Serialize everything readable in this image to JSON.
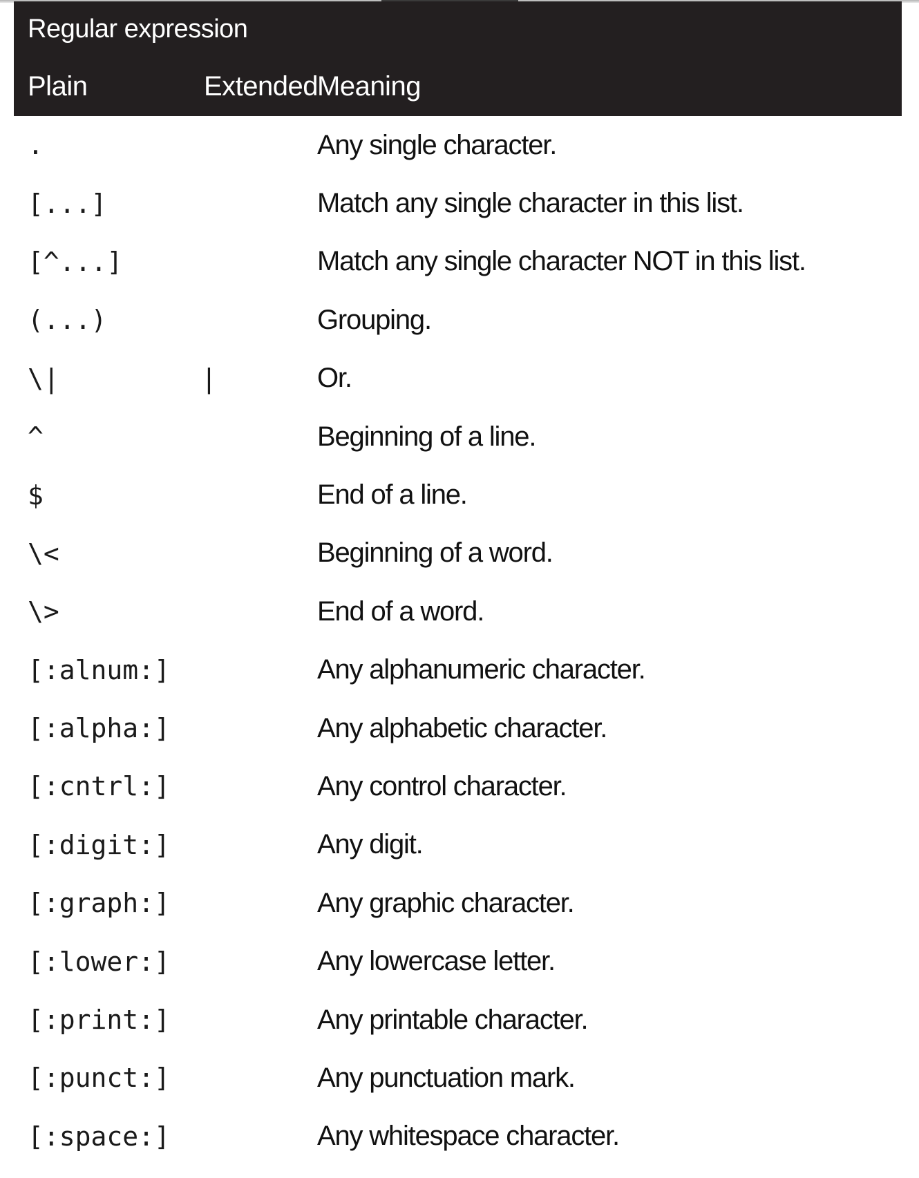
{
  "table": {
    "group_header": "Regular expression",
    "columns": {
      "plain": "Plain",
      "extended": "Extended",
      "meaning": "Meaning"
    },
    "rows": [
      {
        "plain": ".",
        "extended": "",
        "meaning": "Any single character."
      },
      {
        "plain": "[...]",
        "extended": "",
        "meaning": "Match any single character in this list."
      },
      {
        "plain": "[^...]",
        "extended": "",
        "meaning": "Match any single character NOT in this list."
      },
      {
        "plain": "(...)",
        "extended": "",
        "meaning": "Grouping."
      },
      {
        "plain": "\\|",
        "extended": "|",
        "meaning": "Or."
      },
      {
        "plain": "^",
        "extended": "",
        "meaning": "Beginning of a line."
      },
      {
        "plain": "$",
        "extended": "",
        "meaning": "End of a line."
      },
      {
        "plain": "\\<",
        "extended": "",
        "meaning": "Beginning of a word."
      },
      {
        "plain": "\\>",
        "extended": "",
        "meaning": "End of a word."
      },
      {
        "plain": "[:alnum:]",
        "extended": "",
        "meaning": "Any alphanumeric character."
      },
      {
        "plain": "[:alpha:]",
        "extended": "",
        "meaning": "Any alphabetic character."
      },
      {
        "plain": "[:cntrl:]",
        "extended": "",
        "meaning": "Any control character."
      },
      {
        "plain": "[:digit:]",
        "extended": "",
        "meaning": "Any digit."
      },
      {
        "plain": "[:graph:]",
        "extended": "",
        "meaning": "Any graphic character."
      },
      {
        "plain": "[:lower:]",
        "extended": "",
        "meaning": "Any lowercase letter."
      },
      {
        "plain": "[:print:]",
        "extended": "",
        "meaning": "Any printable character."
      },
      {
        "plain": "[:punct:]",
        "extended": "",
        "meaning": "Any punctuation mark."
      },
      {
        "plain": "[:space:]",
        "extended": "",
        "meaning": "Any whitespace character."
      }
    ]
  }
}
